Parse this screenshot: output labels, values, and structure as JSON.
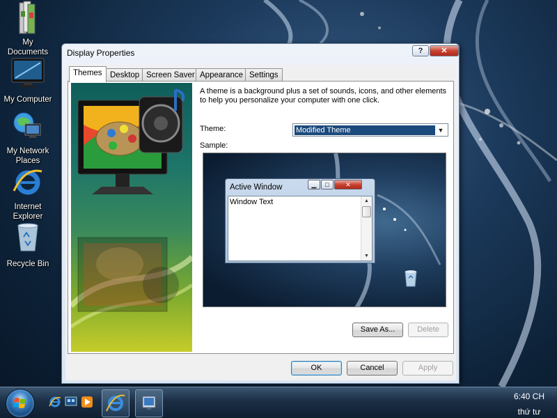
{
  "desktop": {
    "icons": [
      {
        "label": "My\nDocuments",
        "icon": "folder-documents-icon"
      },
      {
        "label": "My Computer",
        "icon": "computer-monitor-icon"
      },
      {
        "label": "My Network\nPlaces",
        "icon": "network-globe-icon"
      },
      {
        "label": "Internet\nExplorer",
        "icon": "internet-explorer-icon"
      },
      {
        "label": "Recycle Bin",
        "icon": "recycle-bin-icon"
      }
    ]
  },
  "dialog": {
    "title": "Display Properties",
    "help_label": "?",
    "close_label": "✕",
    "tabs": [
      {
        "label": "Themes",
        "active": true
      },
      {
        "label": "Desktop"
      },
      {
        "label": "Screen Saver"
      },
      {
        "label": "Appearance"
      },
      {
        "label": "Settings"
      }
    ],
    "description": "A theme is a background plus a set of sounds, icons, and other elements to help you personalize your computer with one click.",
    "theme_label": "Theme:",
    "theme_value": "Modified Theme",
    "sample_label": "Sample:",
    "sample_window": {
      "title": "Active Window",
      "text": "Window Text"
    },
    "save_as_label": "Save As...",
    "delete_label": "Delete",
    "ok_label": "OK",
    "cancel_label": "Cancel",
    "apply_label": "Apply"
  },
  "taskbar": {
    "time": "6:40 CH",
    "day": "thứ tư"
  },
  "colors": {
    "selection": "#1b4a7c",
    "desktop_bg": "#1c3a5c"
  }
}
